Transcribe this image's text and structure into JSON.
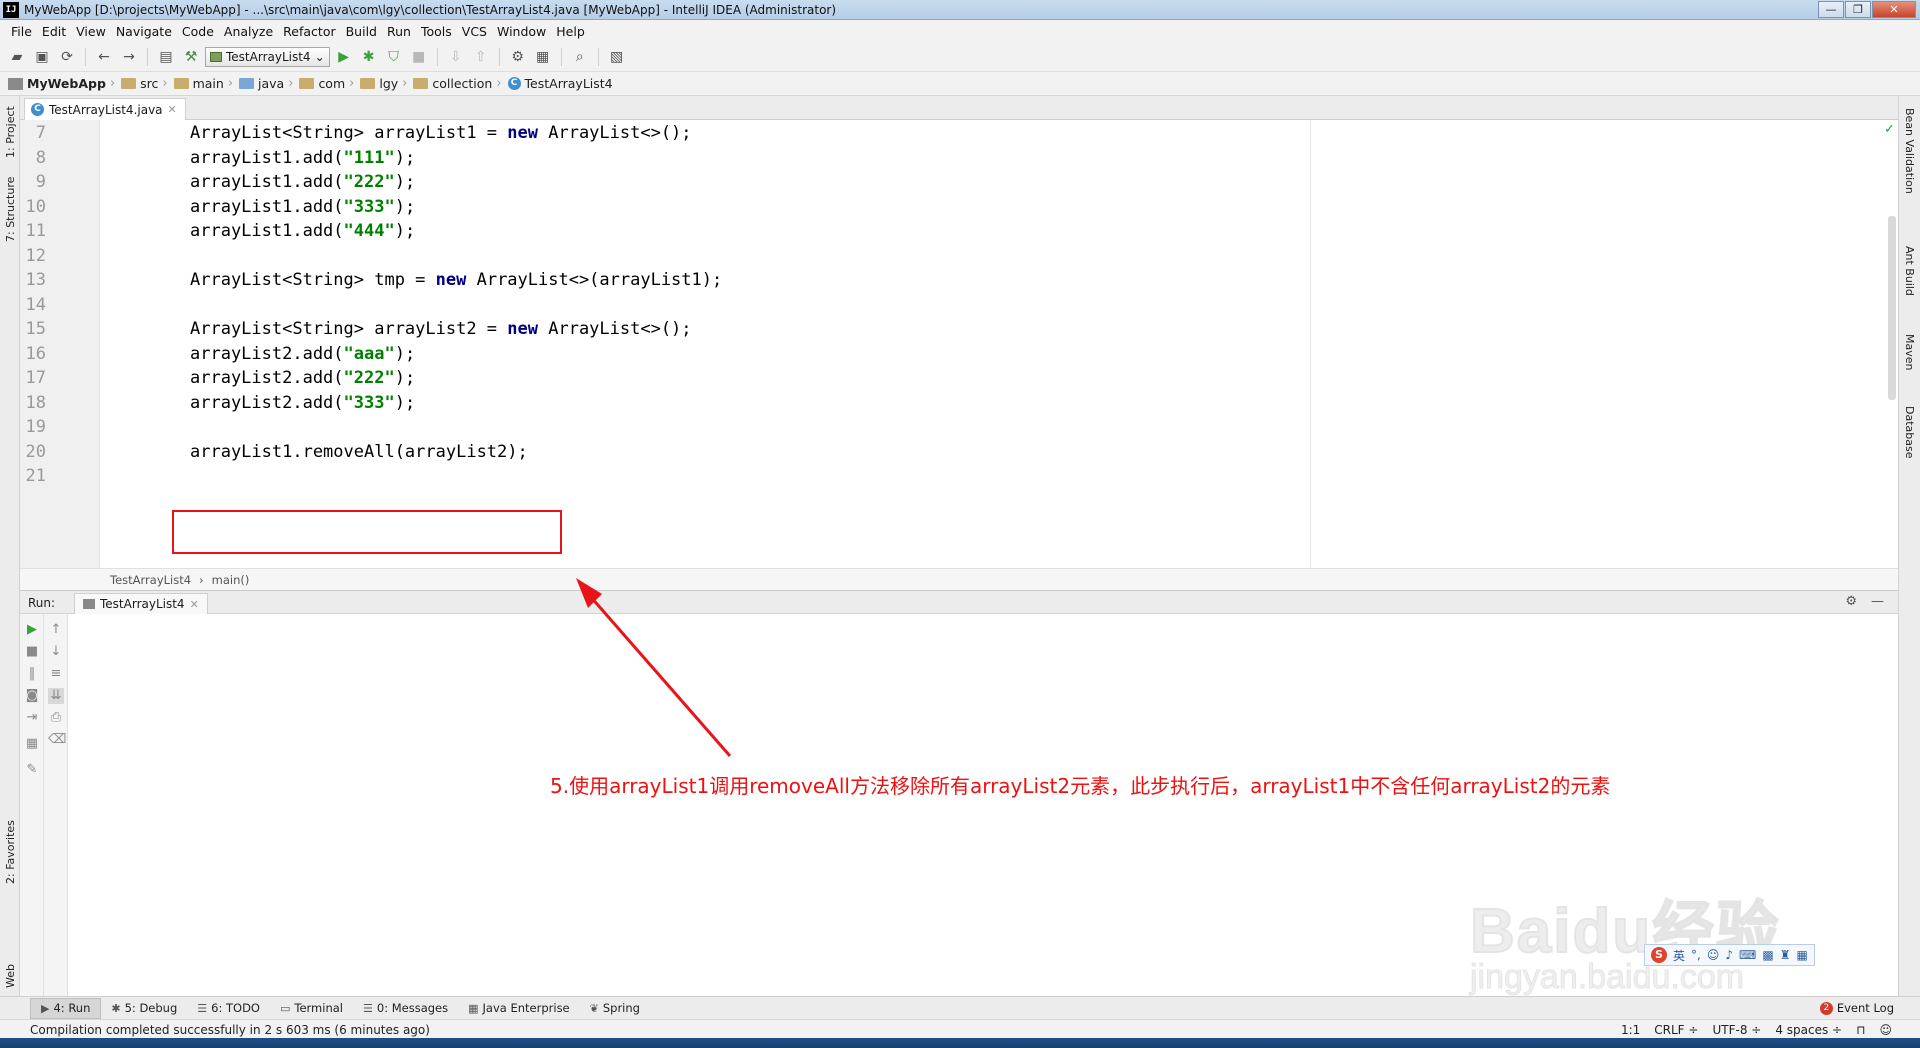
{
  "window": {
    "title": "MyWebApp [D:\\projects\\MyWebApp] - ...\\src\\main\\java\\com\\lgy\\collection\\TestArrayList4.java [MyWebApp] - IntelliJ IDEA (Administrator)",
    "app_icon_text": "IJ",
    "minimize": "—",
    "restore": "❐",
    "close": "✕"
  },
  "menu": [
    "File",
    "Edit",
    "View",
    "Navigate",
    "Code",
    "Analyze",
    "Refactor",
    "Build",
    "Run",
    "Tools",
    "VCS",
    "Window",
    "Help"
  ],
  "toolbar": {
    "run_config": "TestArrayList4"
  },
  "breadcrumb": [
    "MyWebApp",
    "src",
    "main",
    "java",
    "com",
    "lgy",
    "collection",
    "TestArrayList4"
  ],
  "left_tool_tabs": [
    "1: Project",
    "7: Structure",
    "2: Favorites",
    "Web"
  ],
  "right_tool_tabs": [
    "Bean Validation",
    "Ant Build",
    "Maven",
    "Database"
  ],
  "editor": {
    "tab": "TestArrayList4.java",
    "lines": [
      {
        "n": "7",
        "segs": [
          [
            "t",
            "ArrayList<String> arrayList1 = "
          ],
          [
            "k",
            "new"
          ],
          [
            "t",
            " ArrayList<>();"
          ]
        ]
      },
      {
        "n": "8",
        "segs": [
          [
            "t",
            "arrayList1.add("
          ],
          [
            "s",
            "\"111\""
          ],
          [
            "t",
            ");"
          ]
        ]
      },
      {
        "n": "9",
        "segs": [
          [
            "t",
            "arrayList1.add("
          ],
          [
            "s",
            "\"222\""
          ],
          [
            "t",
            ");"
          ]
        ]
      },
      {
        "n": "10",
        "segs": [
          [
            "t",
            "arrayList1.add("
          ],
          [
            "s",
            "\"333\""
          ],
          [
            "t",
            ");"
          ]
        ]
      },
      {
        "n": "11",
        "segs": [
          [
            "t",
            "arrayList1.add("
          ],
          [
            "s",
            "\"444\""
          ],
          [
            "t",
            ");"
          ]
        ]
      },
      {
        "n": "12",
        "segs": []
      },
      {
        "n": "13",
        "segs": [
          [
            "t",
            "ArrayList<String> tmp = "
          ],
          [
            "k",
            "new"
          ],
          [
            "t",
            " ArrayList<>(arrayList1);"
          ]
        ]
      },
      {
        "n": "14",
        "segs": []
      },
      {
        "n": "15",
        "segs": [
          [
            "t",
            "ArrayList<String> arrayList2 = "
          ],
          [
            "k",
            "new"
          ],
          [
            "t",
            " ArrayList<>();"
          ]
        ]
      },
      {
        "n": "16",
        "segs": [
          [
            "t",
            "arrayList2.add("
          ],
          [
            "s",
            "\"aaa\""
          ],
          [
            "t",
            ");"
          ]
        ]
      },
      {
        "n": "17",
        "segs": [
          [
            "t",
            "arrayList2.add("
          ],
          [
            "s",
            "\"222\""
          ],
          [
            "t",
            ");"
          ]
        ]
      },
      {
        "n": "18",
        "segs": [
          [
            "t",
            "arrayList2.add("
          ],
          [
            "s",
            "\"333\""
          ],
          [
            "t",
            ");"
          ]
        ]
      },
      {
        "n": "19",
        "segs": []
      },
      {
        "n": "20",
        "segs": [
          [
            "t",
            "arrayList1.removeAll(arrayList2);"
          ]
        ]
      },
      {
        "n": "21",
        "segs": []
      }
    ],
    "method_breadcrumb": [
      "TestArrayList4",
      "main()"
    ]
  },
  "run_panel": {
    "label": "Run:",
    "tab": "TestArrayList4"
  },
  "annotation": "5.使用arrayList1调用removeAll方法移除所有arrayList2元素，此步执行后，arrayList1中不含任何arrayList2的元素",
  "watermark": {
    "main": "Baidu经验",
    "sub": "jingyan.baidu.com"
  },
  "ime": {
    "lang": "英"
  },
  "bottom_tabs": [
    {
      "label": "4: Run",
      "icon": "▶",
      "active": true
    },
    {
      "label": "5: Debug",
      "icon": "✱",
      "active": false
    },
    {
      "label": "6: TODO",
      "icon": "☰",
      "active": false
    },
    {
      "label": "Terminal",
      "icon": "▭",
      "active": false
    },
    {
      "label": "0: Messages",
      "icon": "☰",
      "active": false
    },
    {
      "label": "Java Enterprise",
      "icon": "▦",
      "active": false
    },
    {
      "label": "Spring",
      "icon": "❦",
      "active": false
    }
  ],
  "event_log": {
    "label": "Event Log",
    "count": "2"
  },
  "status": {
    "message": "Compilation completed successfully in 2 s 603 ms (6 minutes ago)",
    "position": "1:1",
    "line_sep": "CRLF ÷",
    "encoding": "UTF-8 ÷",
    "indent": "4 spaces ÷"
  },
  "colors": {
    "keyword": "#000080",
    "string": "#008000",
    "annotation": "#ee1111",
    "highlight_box": "#e8141a"
  }
}
